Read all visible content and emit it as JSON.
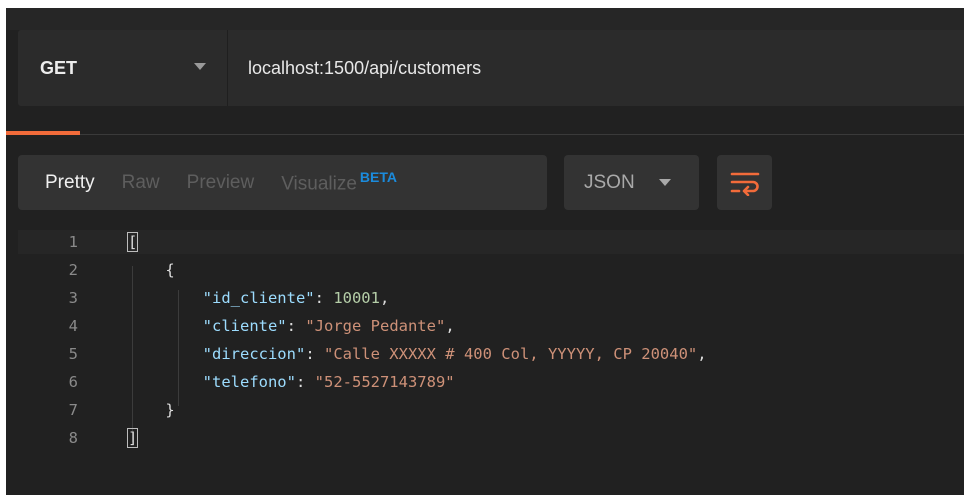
{
  "request": {
    "method": "GET",
    "url": "localhost:1500/api/customers"
  },
  "response": {
    "view_tabs": [
      {
        "label": "Pretty",
        "active": true
      },
      {
        "label": "Raw",
        "active": false
      },
      {
        "label": "Preview",
        "active": false
      },
      {
        "label": "Visualize",
        "active": false,
        "badge": "BETA"
      }
    ],
    "format": "JSON",
    "wrap_icon": "wrap-lines-icon"
  },
  "code": {
    "line_numbers": [
      "1",
      "2",
      "3",
      "4",
      "5",
      "6",
      "7",
      "8"
    ],
    "open_bracket": "[",
    "open_brace": "{",
    "fields": [
      {
        "key": "\"id_cliente\"",
        "value": "10001",
        "type": "number"
      },
      {
        "key": "\"cliente\"",
        "value": "\"Jorge Pedante\"",
        "type": "string"
      },
      {
        "key": "\"direccion\"",
        "value": "\"Calle XXXXX # 400 Col, YYYYY, CP 20040\"",
        "type": "string"
      },
      {
        "key": "\"telefono\"",
        "value": "\"52-5527143789\"",
        "type": "string"
      }
    ],
    "close_brace": "}",
    "close_bracket": "]"
  },
  "colors": {
    "accent": "#f26b3a",
    "beta": "#1b8bdc",
    "key": "#9cdcfe",
    "string": "#ce9178",
    "number": "#b5cea8"
  }
}
